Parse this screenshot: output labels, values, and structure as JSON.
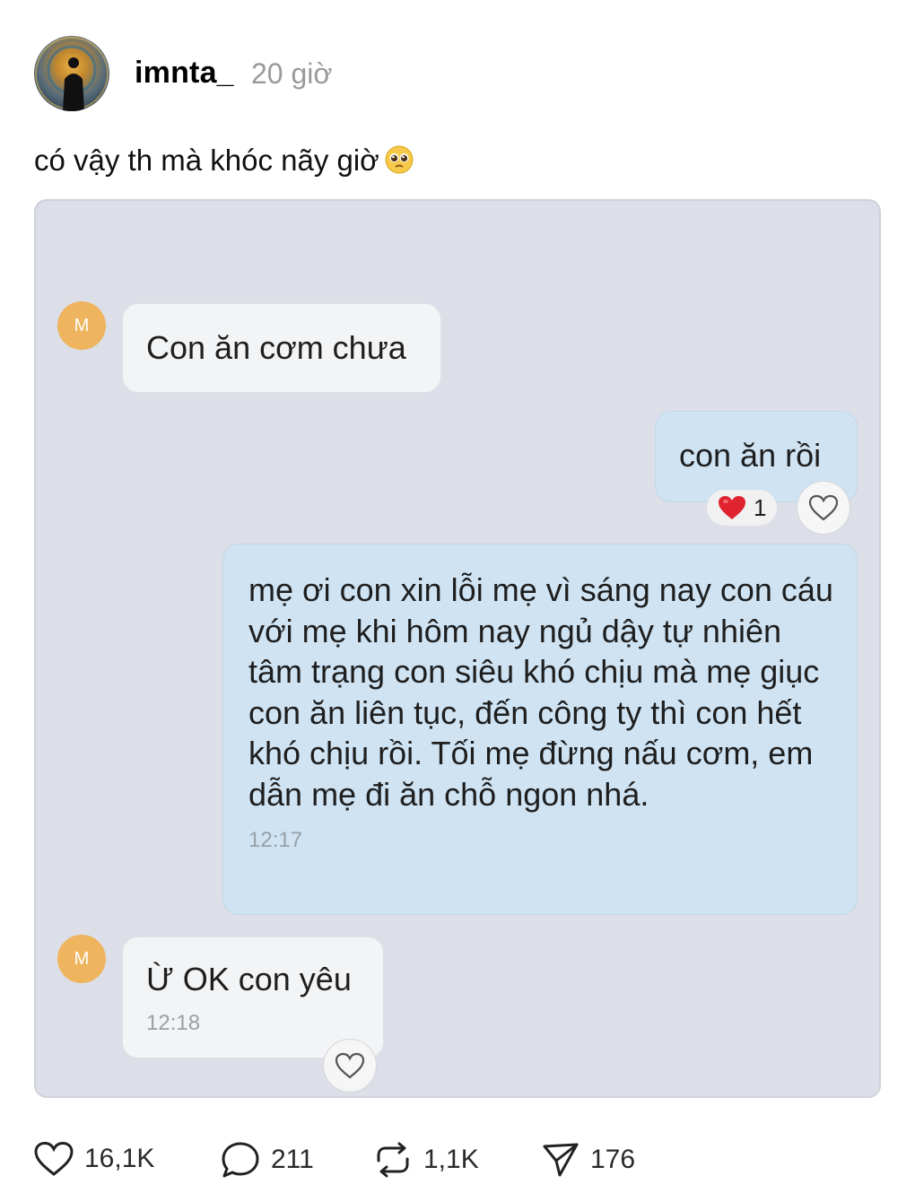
{
  "post": {
    "username": "imnta_",
    "time_ago": "20 giờ",
    "caption": "có vậy th mà khóc nãy giờ",
    "caption_emoji": "pleading-face-emoji"
  },
  "chat": {
    "contact_initial": "M",
    "messages": [
      {
        "id": "m1",
        "side": "in",
        "text": "Con ăn cơm chưa",
        "time": ""
      },
      {
        "id": "m2",
        "side": "out",
        "text": "con ăn rồi",
        "time": "",
        "reaction": {
          "icon": "red-heart",
          "count": "1"
        }
      },
      {
        "id": "m3",
        "side": "out",
        "text": "mẹ ơi con xin lỗi mẹ vì sáng nay con cáu với mẹ khi hôm nay ngủ dậy tự nhiên tâm trạng con siêu khó chịu mà mẹ giục con ăn liên tục, đến công ty thì con hết khó chịu rồi. Tối mẹ đừng nấu cơm, em dẫn mẹ đi ăn chỗ ngon nhá.",
        "time": "12:17"
      },
      {
        "id": "m4",
        "side": "in",
        "text": "Ừ OK con yêu",
        "time": "12:18"
      }
    ]
  },
  "actions": {
    "like_count": "16,1K",
    "comment_count": "211",
    "repost_count": "1,1K",
    "share_count": "176"
  },
  "colors": {
    "chat_bg": "#dcdfe8",
    "bubble_in": "#f3f4f5",
    "bubble_out": "#cfe3f3",
    "contact_avatar": "#eeb45e",
    "reaction_heart": "#e0242f"
  }
}
